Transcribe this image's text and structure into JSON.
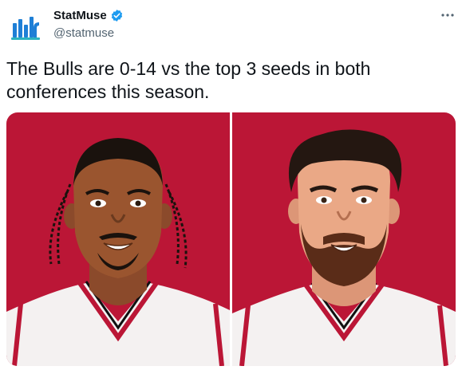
{
  "author": {
    "name": "StatMuse",
    "handle": "@statmuse",
    "verified": true,
    "avatar_icon": "statmuse-logo-icon",
    "brand_color": "#1e7fd6"
  },
  "tweet": {
    "text": "The Bulls are 0-14 vs the top 3 seeds in both conferences this season."
  },
  "menu": {
    "icon": "more-horizontal-icon"
  },
  "media": {
    "background_color": "#bb1636",
    "images": [
      {
        "icon": "player-illustration-left"
      },
      {
        "icon": "player-illustration-right"
      }
    ]
  }
}
